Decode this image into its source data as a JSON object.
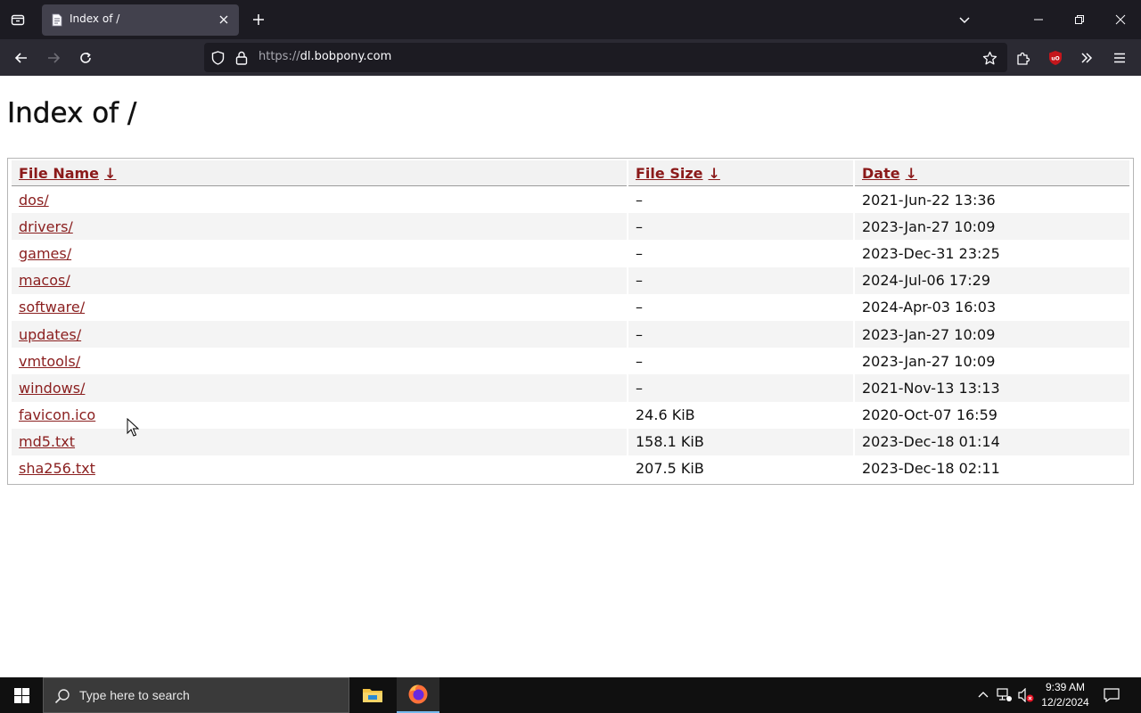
{
  "browser": {
    "tab": {
      "title": "Index of /"
    },
    "url": {
      "prefix": "https://",
      "host": "dl.bobpony.com"
    }
  },
  "page": {
    "title": "Index of /",
    "columns": {
      "name": "File Name",
      "size": "File Size",
      "date": "Date",
      "sort_arrow": "↓"
    },
    "rows": [
      {
        "name": "dos/",
        "size": "–",
        "date": "2021-Jun-22 13:36"
      },
      {
        "name": "drivers/",
        "size": "–",
        "date": "2023-Jan-27 10:09"
      },
      {
        "name": "games/",
        "size": "–",
        "date": "2023-Dec-31 23:25"
      },
      {
        "name": "macos/",
        "size": "–",
        "date": "2024-Jul-06 17:29"
      },
      {
        "name": "software/",
        "size": "–",
        "date": "2024-Apr-03 16:03"
      },
      {
        "name": "updates/",
        "size": "–",
        "date": "2023-Jan-27 10:09"
      },
      {
        "name": "vmtools/",
        "size": "–",
        "date": "2023-Jan-27 10:09"
      },
      {
        "name": "windows/",
        "size": "–",
        "date": "2021-Nov-13 13:13"
      },
      {
        "name": "favicon.ico",
        "size": "24.6 KiB",
        "date": "2020-Oct-07 16:59"
      },
      {
        "name": "md5.txt",
        "size": "158.1 KiB",
        "date": "2023-Dec-18 01:14"
      },
      {
        "name": "sha256.txt",
        "size": "207.5 KiB",
        "date": "2023-Dec-18 02:11"
      }
    ]
  },
  "taskbar": {
    "search_placeholder": "Type here to search",
    "time": "9:39 AM",
    "date": "12/2/2024"
  },
  "icons": {
    "tab_favicon": "document-icon",
    "extension": "ublock-origin-icon"
  },
  "colors": {
    "link": "#8b2020",
    "chrome_dark": "#1c1b22",
    "toolbar": "#2b2a33",
    "extension_badge": "#c4161c"
  }
}
